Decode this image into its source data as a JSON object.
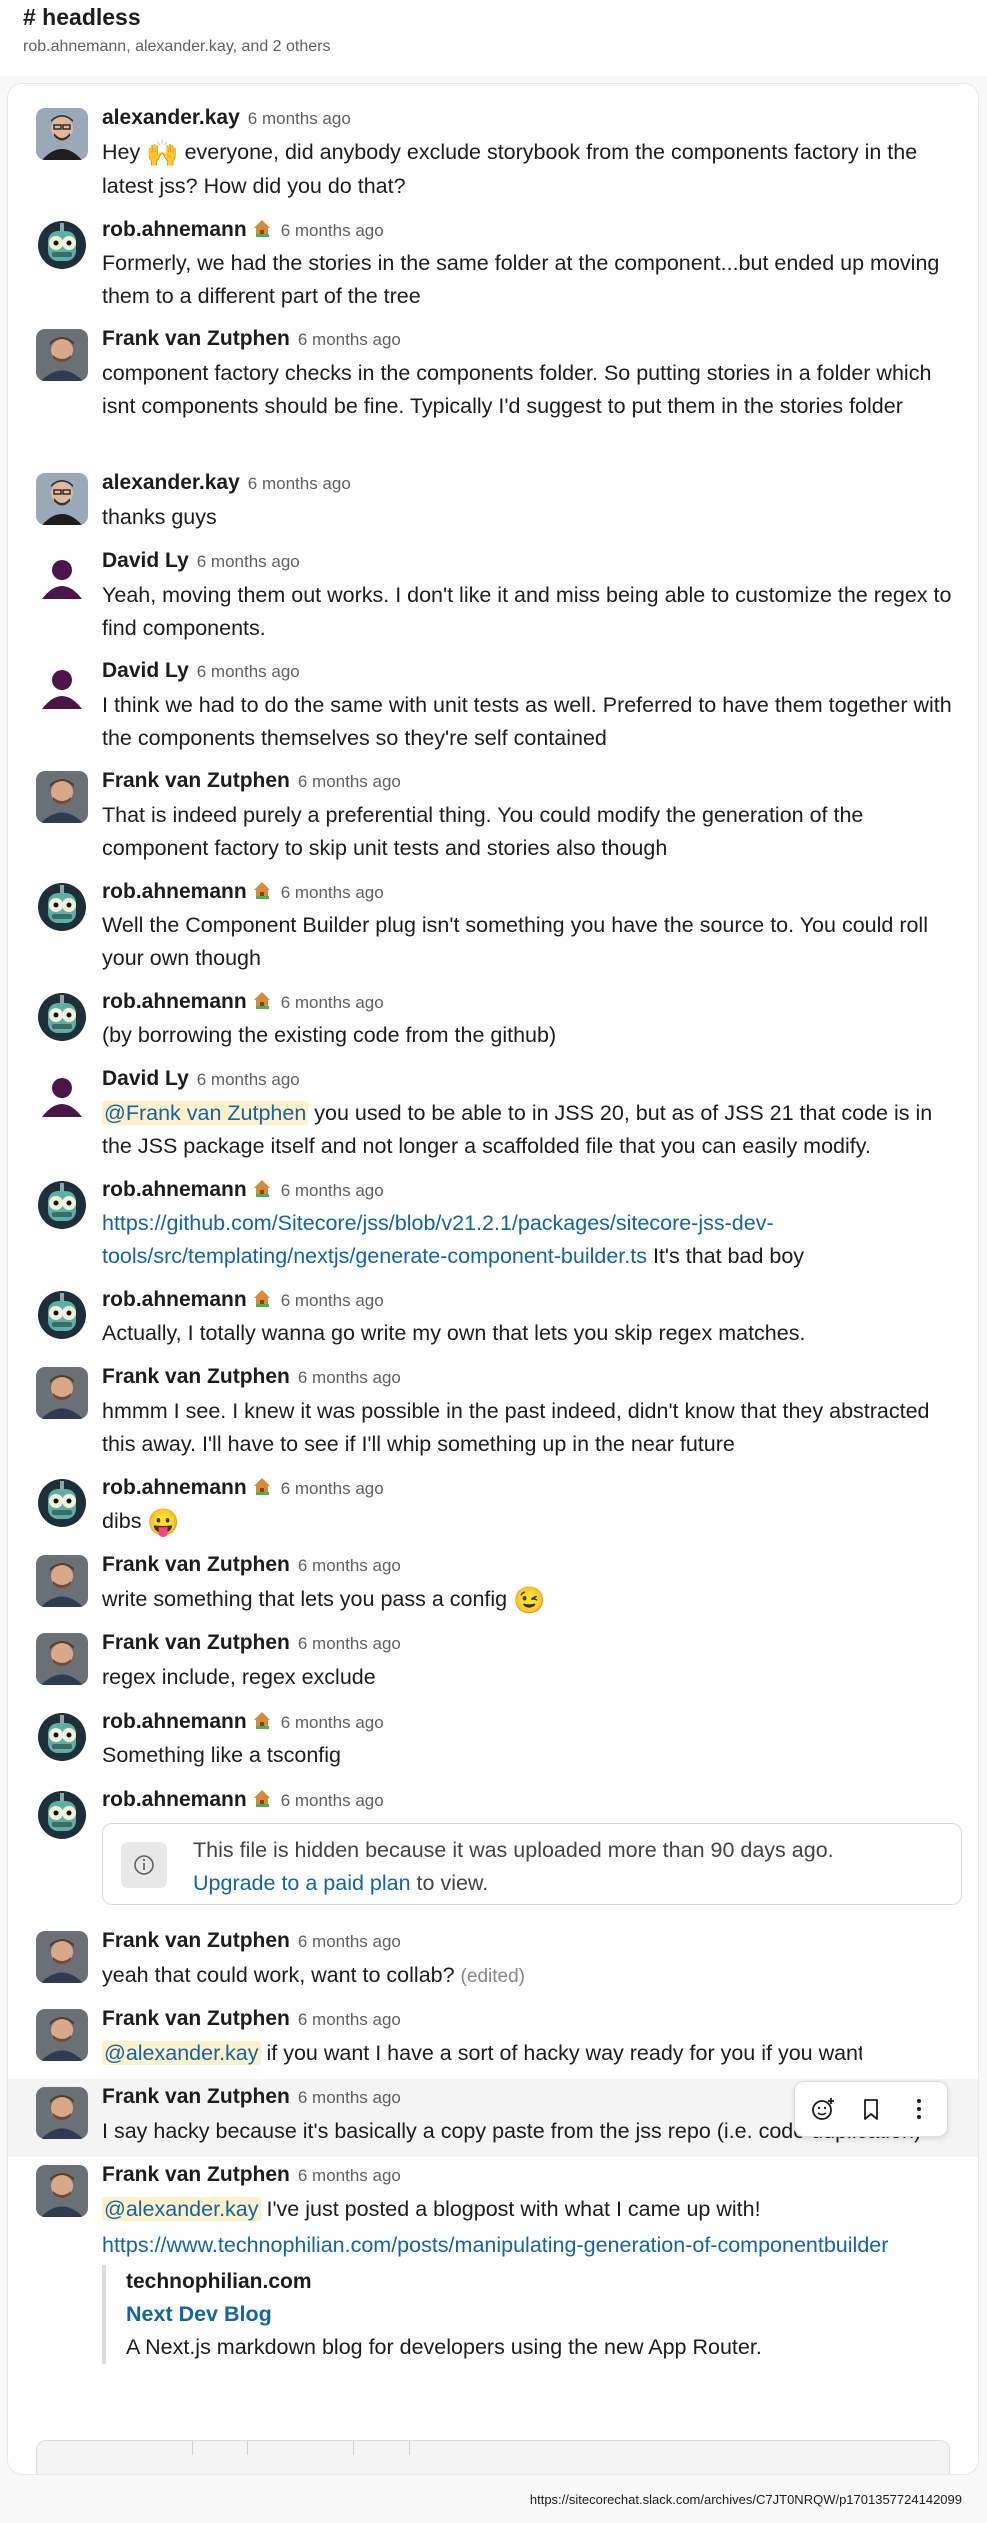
{
  "channel": {
    "title": "# headless",
    "members": "rob.ahnemann, alexander.kay, and 2 others"
  },
  "colors": {
    "link": "#1264a3",
    "mention_bg": "#fdf1cc",
    "text": "#1d1c1d",
    "muted": "#616061"
  },
  "messages": [
    {
      "author": "alexander.kay",
      "time": "6 months ago",
      "parts": [
        {
          "t": "Hey "
        },
        {
          "t": "🙌",
          "cls": "emoji"
        },
        {
          "t": " everyone, did anybody exclude storybook from the components factory in the latest jss? How did you do that?"
        }
      ]
    },
    {
      "author": "rob.ahnemann",
      "time": "6 months ago",
      "parts": [
        {
          "t": "Formerly, we had the stories in the same folder at the component...but ended up moving them to a different part of the tree"
        }
      ]
    },
    {
      "author": "Frank van Zutphen",
      "time": "6 months ago",
      "parts": [
        {
          "t": "component factory checks in the components folder. So putting stories in a folder which isnt components should be fine. Typically I'd suggest to put them in the stories folder"
        }
      ]
    },
    {
      "author": "alexander.kay",
      "time": "6 months ago",
      "parts": [
        {
          "t": "thanks guys"
        }
      ]
    },
    {
      "author": "David Ly",
      "time": "6 months ago",
      "parts": [
        {
          "t": "Yeah, moving them out works.  I don't like it and miss being able to customize the regex to find components."
        }
      ]
    },
    {
      "author": "David Ly",
      "time": "6 months ago",
      "parts": [
        {
          "t": "I think we had to do the same with unit tests as well.  Preferred to have them together with the components themselves so they're self contained"
        }
      ]
    },
    {
      "author": "Frank van Zutphen",
      "time": "6 months ago",
      "parts": [
        {
          "t": "That is indeed purely a preferential thing. You could modify the generation of the component factory to skip unit tests and stories also though"
        }
      ]
    },
    {
      "author": "rob.ahnemann",
      "time": "6 months ago",
      "parts": [
        {
          "t": "Well the Component Builder plug isn't something you have the source to. You could roll your own though"
        }
      ]
    },
    {
      "author": "rob.ahnemann",
      "time": "6 months ago",
      "parts": [
        {
          "t": "(by borrowing the existing code from the github)"
        }
      ]
    },
    {
      "author": "David Ly",
      "time": "6 months ago",
      "parts": [
        {
          "t": "@Frank van Zutphen",
          "cls": "mention"
        },
        {
          "t": " you used to be able to in JSS 20, but as of JSS 21 that code is in the JSS package itself and not longer a scaffolded file that you can easily modify."
        }
      ]
    },
    {
      "author": "rob.ahnemann",
      "time": "6 months ago",
      "parts": [
        {
          "t": "https://github.com/Sitecore/jss/blob/v21.2.1/packages/sitecore-jss-dev-tools/src/templating/nextjs/generate-component-builder.ts",
          "cls": "link"
        },
        {
          "t": " It's that bad boy"
        }
      ]
    },
    {
      "author": "rob.ahnemann",
      "time": "6 months ago",
      "parts": [
        {
          "t": "Actually, I totally wanna go write my own that lets you skip regex matches."
        }
      ]
    },
    {
      "author": "Frank van Zutphen",
      "time": "6 months ago",
      "parts": [
        {
          "t": "hmmm I see. I knew it was possible in the past indeed, didn't know that they abstracted this away. I'll have to see if I'll whip something up in the near future"
        }
      ]
    },
    {
      "author": "rob.ahnemann",
      "time": "6 months ago",
      "parts": [
        {
          "t": "dibs "
        },
        {
          "t": "😛",
          "cls": "emoji"
        }
      ]
    },
    {
      "author": "Frank van Zutphen",
      "time": "6 months ago",
      "parts": [
        {
          "t": "write something that lets you pass a config "
        },
        {
          "t": "😉",
          "cls": "emoji"
        }
      ]
    },
    {
      "author": "Frank van Zutphen",
      "time": "6 months ago",
      "parts": [
        {
          "t": "regex include, regex exclude"
        }
      ]
    },
    {
      "author": "rob.ahnemann",
      "time": "6 months ago",
      "parts": [
        {
          "t": "Something like a tsconfig"
        }
      ]
    },
    {
      "author": "rob.ahnemann",
      "time": "6 months ago",
      "parts": []
    },
    {
      "author": "Frank van Zutphen",
      "time": "6 months ago",
      "parts": [
        {
          "t": "yeah that could work, want to collab? "
        },
        {
          "t": "(edited)",
          "cls": "edited"
        }
      ]
    },
    {
      "author": "Frank van Zutphen",
      "time": "6 months ago",
      "parts": [
        {
          "t": "@alexander.kay",
          "cls": "mention"
        },
        {
          "t": " if you want I have a sort of hacky way ready for you if you want"
        }
      ]
    },
    {
      "author": "Frank van Zutphen",
      "time": "6 months ago",
      "parts": [
        {
          "t": "I say hacky because it's basically a copy paste from the jss repo (i.e. code duplication)"
        }
      ]
    },
    {
      "author": "Frank van Zutphen",
      "time": "6 months ago",
      "parts": [
        {
          "t": "@alexander.kay",
          "cls": "mention"
        },
        {
          "t": " I've just posted a blogpost with what I came up with!"
        }
      ]
    }
  ],
  "hidden_file": {
    "text": "This file is hidden because it was uploaded more than 90 days ago.",
    "link": "Upgrade to a paid plan",
    "suffix": " to view."
  },
  "last_link": "https://www.technophilian.com/posts/manipulating-generation-of-componentbuilder",
  "unfurl": {
    "site": "technophilian.com",
    "title": "Next Dev Blog",
    "description": "A Next.js markdown blog for developers using the new App Router."
  },
  "toolbar_icons": [
    "add-reaction-icon",
    "bookmark-icon",
    "more-actions-icon"
  ],
  "footer_url": "https://sitecorechat.slack.com/archives/C7JT0NRQW/p1701357724142099"
}
